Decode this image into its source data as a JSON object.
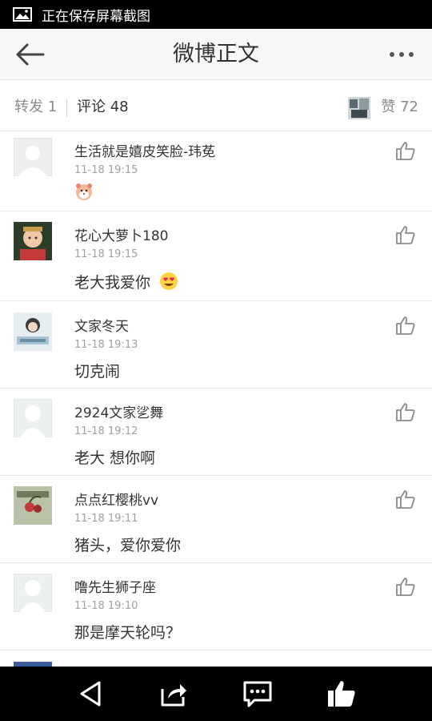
{
  "status_bar": {
    "icon": "image-icon",
    "text": "正在保存屏幕截图"
  },
  "title_bar": {
    "back_icon": "back-arrow-icon",
    "title": "微博正文",
    "more_icon": "more-dots-icon"
  },
  "tabs": {
    "repost": "转发 1",
    "comment": "评论 48",
    "likes": "赞 72"
  },
  "comments": [
    {
      "name": "生活就是嬉皮笑脸-玮莬",
      "time": "11-18 19:15",
      "text": "",
      "emoji": "hamster-emoji"
    },
    {
      "name": "花心大萝卜180",
      "time": "11-18 19:15",
      "text": "老大我爱你",
      "emoji": "heart-eyes-emoji"
    },
    {
      "name": "文家冬天",
      "time": "11-18 19:13",
      "text": "切克闹"
    },
    {
      "name": "2924文家乷舞",
      "time": "11-18 19:12",
      "text": "老大 想你啊"
    },
    {
      "name": "点点红樱桃vv",
      "time": "11-18 19:11",
      "text": "猪头，爱你爱你"
    },
    {
      "name": "噜先生狮子座",
      "time": "11-18 19:10",
      "text": "那是摩天轮吗？"
    }
  ],
  "bottom_bar": {
    "icons": [
      "back-triangle-icon",
      "share-icon",
      "comment-icon",
      "like-icon"
    ]
  },
  "colors": {
    "status_bg": "#000000",
    "title_bg": "#f7f7f7",
    "text": "#333333",
    "muted": "#a0a0a0",
    "divider": "#e8e8e8"
  }
}
